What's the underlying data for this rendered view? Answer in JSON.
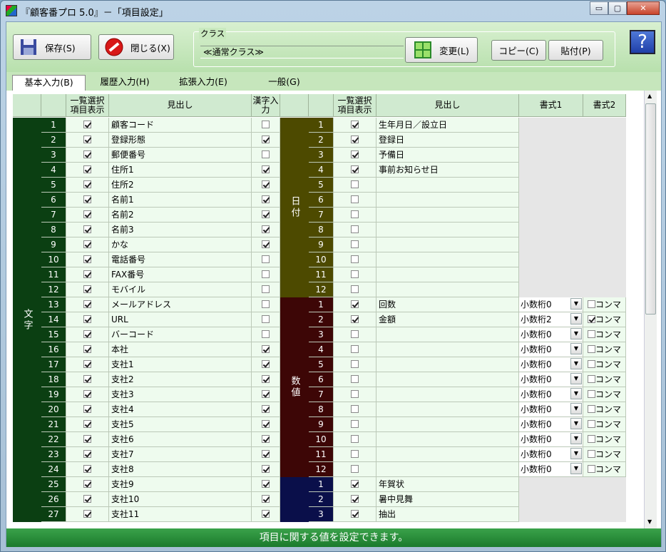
{
  "window": {
    "title": "『顧客番プロ 5.0』－「項目設定」",
    "min": "▭",
    "max": "▢",
    "close": "✕"
  },
  "toolbar": {
    "save": "保存(S)",
    "close": "閉じる(X)",
    "class_group": "クラス",
    "class_value": "≪通常クラス≫",
    "change": "変更(L)",
    "copy": "コピー(C)",
    "paste": "貼付(P)",
    "help": "?"
  },
  "tabs": [
    {
      "label": "基本入力(B)"
    },
    {
      "label": "履歴入力(H)"
    },
    {
      "label": "拡張入力(E)"
    },
    {
      "label": "一般(G)"
    }
  ],
  "headers": {
    "list_display": "一覧選択項目表示",
    "heading": "見出し",
    "kanji": "漢字入力",
    "list_display2": "一覧選択項目表示",
    "heading2": "見出し",
    "fmt1": "書式1",
    "fmt2": "書式2"
  },
  "groups": {
    "text": "文字",
    "date": "日付",
    "number": "数値"
  },
  "colors": {
    "text_group": "#0b3f12",
    "date_group": "#4d4a00",
    "number_group": "#3d0606",
    "other_group": "#0a0f4a",
    "statusbar": "#2a8c3a"
  },
  "text_rows": [
    {
      "n": "1",
      "list": true,
      "label": "顧客コード",
      "kanji": false
    },
    {
      "n": "2",
      "list": true,
      "label": "登録形態",
      "kanji": true
    },
    {
      "n": "3",
      "list": true,
      "label": "郵便番号",
      "kanji": false
    },
    {
      "n": "4",
      "list": true,
      "label": "住所1",
      "kanji": true
    },
    {
      "n": "5",
      "list": true,
      "label": "住所2",
      "kanji": true
    },
    {
      "n": "6",
      "list": true,
      "label": "名前1",
      "kanji": true
    },
    {
      "n": "7",
      "list": true,
      "label": "名前2",
      "kanji": true
    },
    {
      "n": "8",
      "list": true,
      "label": "名前3",
      "kanji": true
    },
    {
      "n": "9",
      "list": true,
      "label": "かな",
      "kanji": true
    },
    {
      "n": "10",
      "list": true,
      "label": "電話番号",
      "kanji": false
    },
    {
      "n": "11",
      "list": true,
      "label": "FAX番号",
      "kanji": false
    },
    {
      "n": "12",
      "list": true,
      "label": "モバイル",
      "kanji": false
    },
    {
      "n": "13",
      "list": true,
      "label": "メールアドレス",
      "kanji": false
    },
    {
      "n": "14",
      "list": true,
      "label": "URL",
      "kanji": false
    },
    {
      "n": "15",
      "list": true,
      "label": "バーコード",
      "kanji": false
    },
    {
      "n": "16",
      "list": true,
      "label": "本社",
      "kanji": true
    },
    {
      "n": "17",
      "list": true,
      "label": "支社1",
      "kanji": true
    },
    {
      "n": "18",
      "list": true,
      "label": "支社2",
      "kanji": true
    },
    {
      "n": "19",
      "list": true,
      "label": "支社3",
      "kanji": true
    },
    {
      "n": "20",
      "list": true,
      "label": "支社4",
      "kanji": true
    },
    {
      "n": "21",
      "list": true,
      "label": "支社5",
      "kanji": true
    },
    {
      "n": "22",
      "list": true,
      "label": "支社6",
      "kanji": true
    },
    {
      "n": "23",
      "list": true,
      "label": "支社7",
      "kanji": true
    },
    {
      "n": "24",
      "list": true,
      "label": "支社8",
      "kanji": true
    },
    {
      "n": "25",
      "list": true,
      "label": "支社9",
      "kanji": true
    },
    {
      "n": "26",
      "list": true,
      "label": "支社10",
      "kanji": true
    },
    {
      "n": "27",
      "list": true,
      "label": "支社11",
      "kanji": true
    }
  ],
  "date_rows": [
    {
      "n": "1",
      "list": true,
      "label": "生年月日／設立日"
    },
    {
      "n": "2",
      "list": true,
      "label": "登録日"
    },
    {
      "n": "3",
      "list": true,
      "label": "予備日"
    },
    {
      "n": "4",
      "list": true,
      "label": "事前お知らせ日"
    },
    {
      "n": "5",
      "list": false,
      "label": ""
    },
    {
      "n": "6",
      "list": false,
      "label": ""
    },
    {
      "n": "7",
      "list": false,
      "label": ""
    },
    {
      "n": "8",
      "list": false,
      "label": ""
    },
    {
      "n": "9",
      "list": false,
      "label": ""
    },
    {
      "n": "10",
      "list": false,
      "label": ""
    },
    {
      "n": "11",
      "list": false,
      "label": ""
    },
    {
      "n": "12",
      "list": false,
      "label": ""
    }
  ],
  "number_rows": [
    {
      "n": "1",
      "list": true,
      "label": "回数",
      "fmt": "小数桁0",
      "comma": false
    },
    {
      "n": "2",
      "list": true,
      "label": "金額",
      "fmt": "小数桁2",
      "comma": true
    },
    {
      "n": "3",
      "list": false,
      "label": "",
      "fmt": "小数桁0",
      "comma": false
    },
    {
      "n": "4",
      "list": false,
      "label": "",
      "fmt": "小数桁0",
      "comma": false
    },
    {
      "n": "5",
      "list": false,
      "label": "",
      "fmt": "小数桁0",
      "comma": false
    },
    {
      "n": "6",
      "list": false,
      "label": "",
      "fmt": "小数桁0",
      "comma": false
    },
    {
      "n": "7",
      "list": false,
      "label": "",
      "fmt": "小数桁0",
      "comma": false
    },
    {
      "n": "8",
      "list": false,
      "label": "",
      "fmt": "小数桁0",
      "comma": false
    },
    {
      "n": "9",
      "list": false,
      "label": "",
      "fmt": "小数桁0",
      "comma": false
    },
    {
      "n": "10",
      "list": false,
      "label": "",
      "fmt": "小数桁0",
      "comma": false
    },
    {
      "n": "11",
      "list": false,
      "label": "",
      "fmt": "小数桁0",
      "comma": false
    },
    {
      "n": "12",
      "list": false,
      "label": "",
      "fmt": "小数桁0",
      "comma": false
    }
  ],
  "other_rows": [
    {
      "n": "1",
      "list": true,
      "label": "年賀状"
    },
    {
      "n": "2",
      "list": true,
      "label": "暑中見舞"
    },
    {
      "n": "3",
      "list": true,
      "label": "抽出"
    }
  ],
  "comma_label": "コンマ",
  "status": "項目に関する値を設定できます。"
}
